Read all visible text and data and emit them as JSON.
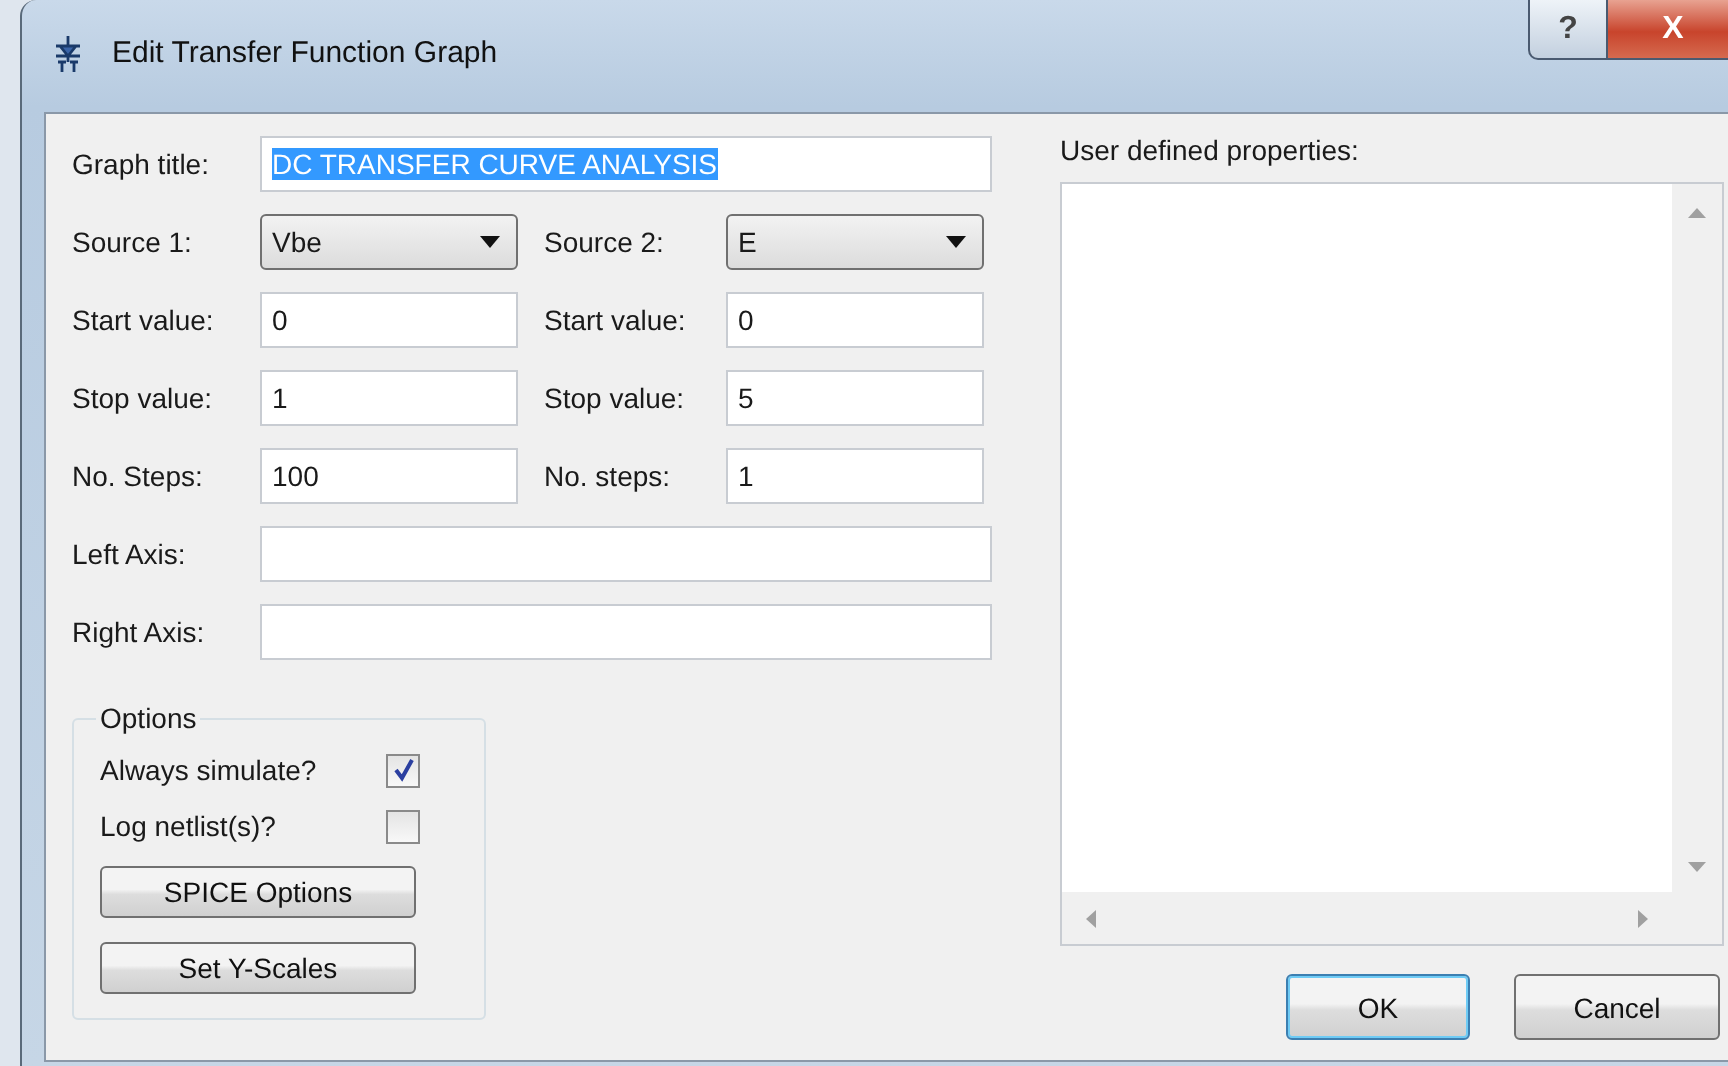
{
  "window": {
    "title": "Edit Transfer Function Graph",
    "help_button": "?",
    "close_button": "X"
  },
  "graph_title": {
    "label": "Graph title:",
    "value": "DC TRANSFER CURVE ANALYSIS",
    "text_selected": true
  },
  "sources": [
    {
      "label": "Source 1:",
      "value": "Vbe",
      "start_label": "Start value:",
      "start": "0",
      "stop_label": "Stop value:",
      "stop": "1",
      "steps_label": "No. Steps:",
      "steps": "100"
    },
    {
      "label": "Source 2:",
      "value": "E",
      "start_label": "Start value:",
      "start": "0",
      "stop_label": "Stop value:",
      "stop": "5",
      "steps_label": "No. steps:",
      "steps": "1"
    }
  ],
  "axes": [
    {
      "label": "Left Axis:"
    },
    {
      "label": "Right Axis:"
    }
  ],
  "options": {
    "title": "Options",
    "checkboxes": [
      {
        "label": "Always simulate?",
        "checked": true
      },
      {
        "label": "Log netlist(s)?",
        "checked": false
      }
    ],
    "buttons": [
      "SPICE Options",
      "Set Y-Scales"
    ]
  },
  "properties": {
    "label": "User defined properties:"
  },
  "buttons": [
    {
      "label": "OK",
      "default": true
    },
    {
      "label": "Cancel",
      "default": false
    }
  ]
}
